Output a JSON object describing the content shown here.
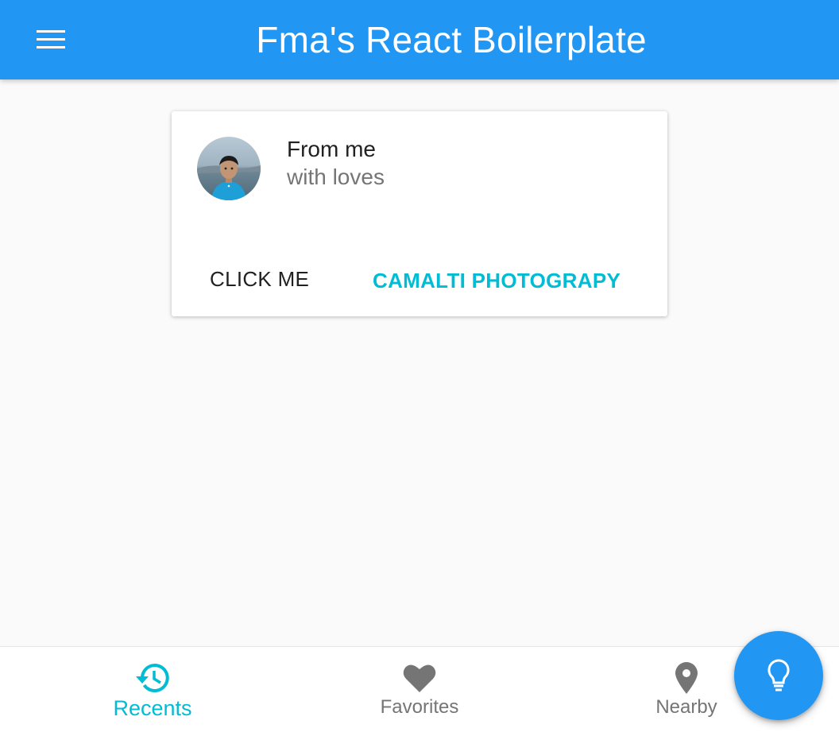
{
  "app_bar": {
    "title": "Fma's React Boilerplate",
    "menu_icon": "hamburger-menu-icon",
    "color": "#2196f3"
  },
  "card": {
    "avatar_icon": "profile-photo",
    "title": "From me",
    "subtitle": "with loves",
    "actions": [
      {
        "label": "CLICK ME"
      },
      {
        "label": "CAMALTI PHOTOGRAPY"
      }
    ],
    "accent_color": "#00bcd4"
  },
  "bottom_nav": {
    "items": [
      {
        "label": "Recents",
        "icon": "history-icon",
        "active": true
      },
      {
        "label": "Favorites",
        "icon": "heart-icon",
        "active": false
      },
      {
        "label": "Nearby",
        "icon": "location-pin-icon",
        "active": false
      }
    ],
    "active_color": "#00bcd4",
    "inactive_color": "#757575"
  },
  "fab": {
    "icon": "lightbulb-icon",
    "color": "#2196f3"
  }
}
